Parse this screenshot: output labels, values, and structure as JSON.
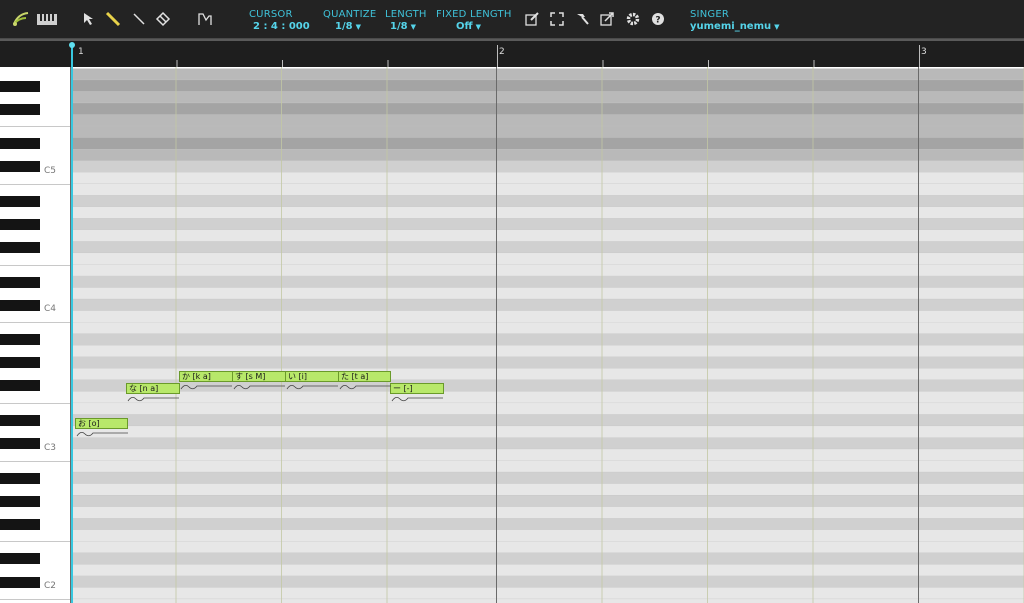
{
  "toolbar": {
    "cursor": {
      "label": "CURSOR",
      "value": "2 : 4 : 000"
    },
    "quantize": {
      "label": "QUANTIZE",
      "value": "1/8"
    },
    "length": {
      "label": "LENGTH",
      "value": "1/8"
    },
    "fixed_length": {
      "label": "FIXED LENGTH",
      "value": "Off"
    },
    "singer": {
      "label": "SINGER",
      "value": "yumemi_nemu"
    }
  },
  "ruler": {
    "bars": [
      "1",
      "2",
      "3"
    ]
  },
  "keyboard": {
    "octave_labels": [
      "C5",
      "C4",
      "C3",
      "C2"
    ]
  },
  "notes": [
    {
      "lyric": "お [o]"
    },
    {
      "lyric": "な [n a]"
    },
    {
      "lyric": "か [k a]"
    },
    {
      "lyric": "す [s M]"
    },
    {
      "lyric": "い [i]"
    },
    {
      "lyric": "た [t a]"
    },
    {
      "lyric": "ー [-]"
    }
  ],
  "colors": {
    "accent": "#3fc1d8",
    "note_fill": "#b8e86a",
    "note_border": "#6a9a2a",
    "playhead": "#38c8e0"
  }
}
